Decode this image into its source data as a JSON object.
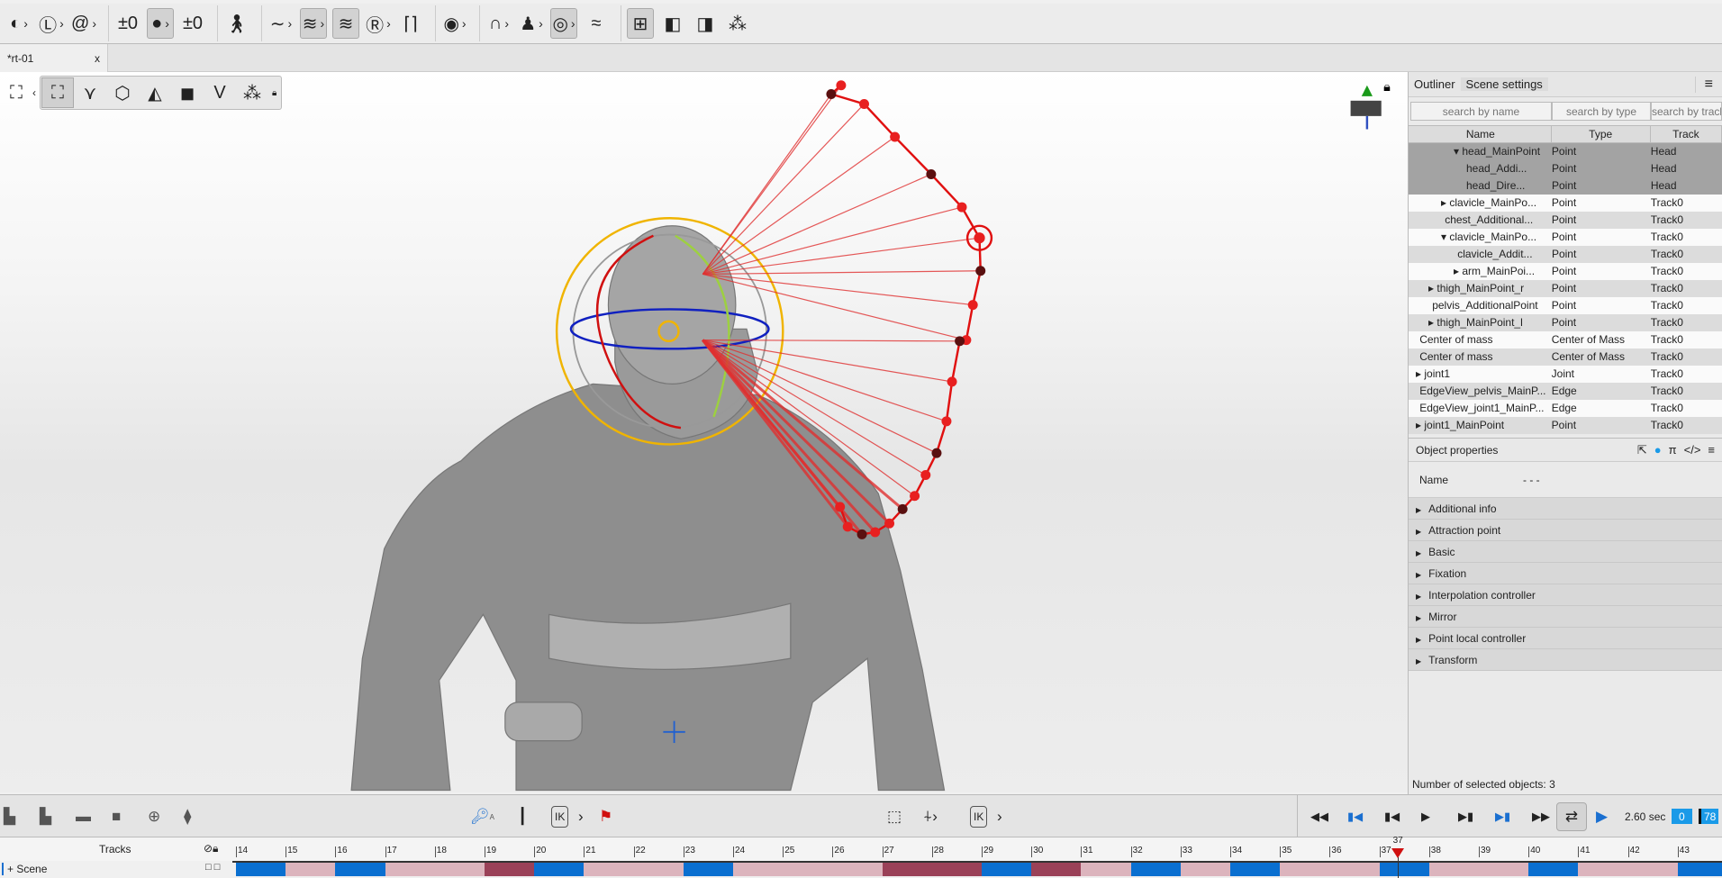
{
  "toolbar": [
    {
      "icon": "globe-icon",
      "glyph": "◐",
      "chev": true
    },
    {
      "icon": "local-L-icon",
      "glyph": "Ⓛ",
      "chev": true
    },
    {
      "icon": "spiral-icon",
      "glyph": "@",
      "chev": true,
      "sep": true
    },
    {
      "icon": "plus-zero-icon",
      "glyph": "±0"
    },
    {
      "icon": "dot-key-icon",
      "glyph": "●",
      "chev": true,
      "on": true
    },
    {
      "icon": "plus-zero-icon-2",
      "glyph": "±0",
      "sep": true
    },
    {
      "icon": "person-icon",
      "glyph": "🚶︎",
      "sep": true
    },
    {
      "icon": "curve-icon",
      "glyph": "∼",
      "chev": true
    },
    {
      "icon": "wave-lock-icon",
      "glyph": "≋",
      "chev": true,
      "on": true
    },
    {
      "icon": "wave-pen-icon",
      "glyph": "≋",
      "on": true
    },
    {
      "icon": "r-icon",
      "glyph": "Ⓡ",
      "chev": true
    },
    {
      "icon": "bracket-icon",
      "glyph": "⌈⌉",
      "sep": true
    },
    {
      "icon": "camera-icon",
      "glyph": "◉",
      "chev": true,
      "sep": true
    },
    {
      "icon": "arc-add-icon",
      "glyph": "∩",
      "chev": true
    },
    {
      "icon": "figure-icon",
      "glyph": "♟",
      "chev": true
    },
    {
      "icon": "target-lock-icon",
      "glyph": "◎",
      "chev": true,
      "on": true
    },
    {
      "icon": "wave-icon",
      "glyph": "≈",
      "sep": true
    },
    {
      "icon": "grid-icon",
      "glyph": "⊞",
      "on": true
    },
    {
      "icon": "layer-add-icon",
      "glyph": "◧"
    },
    {
      "icon": "layer-remove-icon",
      "glyph": "◨"
    },
    {
      "icon": "nodes-p-icon",
      "glyph": "⁂"
    }
  ],
  "tab": {
    "label": "*rt-01",
    "close": "x"
  },
  "viewtools": [
    "frame-icon",
    "bone-icon",
    "cube-wire-icon",
    "cube-edge-icon",
    "cube-solid-icon",
    "v-icon",
    "nodes-icon"
  ],
  "outliner": {
    "tabs": [
      "Outliner",
      "Scene settings"
    ],
    "menu": "≡",
    "search": [
      "search by name",
      "search by type",
      "search by track"
    ],
    "columns": [
      "Name",
      "Type",
      "Track"
    ],
    "rows": [
      {
        "name": "▾ head_MainPoint",
        "type": "Point",
        "track": "Head",
        "indent": 3,
        "style": "sel"
      },
      {
        "name": "head_Addi...",
        "type": "Point",
        "track": "Head",
        "indent": 4,
        "style": "sel"
      },
      {
        "name": "head_Dire...",
        "type": "Point",
        "track": "Head",
        "indent": 4,
        "style": "sel"
      },
      {
        "name": "▸ clavicle_MainPo...",
        "type": "Point",
        "track": "Track0",
        "indent": 2,
        "style": "plain"
      },
      {
        "name": "chest_Additional...",
        "type": "Point",
        "track": "Track0",
        "indent": 2.3,
        "style": "alt"
      },
      {
        "name": "▾ clavicle_MainPo...",
        "type": "Point",
        "track": "Track0",
        "indent": 2,
        "style": "plain"
      },
      {
        "name": "clavicle_Addit...",
        "type": "Point",
        "track": "Track0",
        "indent": 3.3,
        "style": "alt"
      },
      {
        "name": "▸ arm_MainPoi...",
        "type": "Point",
        "track": "Track0",
        "indent": 3,
        "style": "plain"
      },
      {
        "name": "▸ thigh_MainPoint_r",
        "type": "Point",
        "track": "Track0",
        "indent": 1,
        "style": "alt"
      },
      {
        "name": "pelvis_AdditionalPoint",
        "type": "Point",
        "track": "Track0",
        "indent": 1.3,
        "style": "plain"
      },
      {
        "name": "▸ thigh_MainPoint_l",
        "type": "Point",
        "track": "Track0",
        "indent": 1,
        "style": "alt"
      },
      {
        "name": "Center of mass",
        "type": "Center of Mass",
        "track": "Track0",
        "indent": 0.3,
        "style": "plain"
      },
      {
        "name": "Center of mass",
        "type": "Center of Mass",
        "track": "Track0",
        "indent": 0.3,
        "style": "alt"
      },
      {
        "name": "▸ joint1",
        "type": "Joint",
        "track": "Track0",
        "indent": 0,
        "style": "plain"
      },
      {
        "name": "EdgeView_pelvis_MainP...",
        "type": "Edge",
        "track": "Track0",
        "indent": 0.3,
        "style": "alt"
      },
      {
        "name": "EdgeView_joint1_MainP...",
        "type": "Edge",
        "track": "Track0",
        "indent": 0.3,
        "style": "plain"
      },
      {
        "name": "▸ joint1_MainPoint",
        "type": "Point",
        "track": "Track0",
        "indent": 0,
        "style": "alt"
      }
    ]
  },
  "properties": {
    "title": "Object properties",
    "icons": [
      {
        "icon": "add-icon",
        "glyph": "⇱"
      },
      {
        "icon": "color-drop-icon",
        "glyph": "●"
      },
      {
        "icon": "pi-icon",
        "glyph": "π"
      },
      {
        "icon": "code-icon",
        "glyph": "</>"
      },
      {
        "icon": "menu-icon",
        "glyph": "≡"
      }
    ],
    "name_label": "Name",
    "name_value": "- - -",
    "sections": [
      "Additional info",
      "Attraction point",
      "Basic",
      "Fixation",
      "Interpolation controller",
      "Mirror",
      "Point local controller",
      "Transform"
    ]
  },
  "status": "Number of selected objects: 3",
  "bottom": {
    "left_icons": [
      "track-add-icon",
      "track-add-child-icon",
      "track-remove-icon",
      "track-solid-icon",
      "track-center-icon",
      "track-split-icon"
    ],
    "key_label": "A",
    "ik_label": "IK",
    "ik_label2": "IK",
    "playback": [
      {
        "icon": "rewind-icon",
        "glyph": "◀◀"
      },
      {
        "icon": "first-key-icon",
        "glyph": "▮◀"
      },
      {
        "icon": "prev-frame-icon",
        "glyph": "▮◀"
      },
      {
        "icon": "play-icon",
        "glyph": "▶"
      },
      {
        "icon": "next-frame-icon",
        "glyph": "▶▮"
      },
      {
        "icon": "last-key-icon",
        "glyph": "▶▮"
      },
      {
        "icon": "fast-forward-icon",
        "glyph": "▶▶"
      }
    ],
    "time": "2.60 sec",
    "range_start": "0",
    "range_end": "78"
  },
  "timeline": {
    "tracks_label": "Tracks",
    "scene_label": "Scene",
    "current_frame": "37",
    "frames": [
      14,
      15,
      16,
      17,
      18,
      19,
      20,
      21,
      22,
      23,
      24,
      25,
      26,
      27,
      28,
      29,
      30,
      31,
      32,
      33,
      34,
      35,
      36,
      37,
      38,
      39,
      40,
      41,
      42,
      43
    ],
    "segments": [
      "b",
      "p",
      "b",
      "p",
      "p",
      "m",
      "b",
      "p",
      "p",
      "b",
      "p",
      "p",
      "p",
      "m",
      "m",
      "b",
      "m",
      "p",
      "b",
      "p",
      "b",
      "p",
      "p",
      "b",
      "p",
      "p",
      "b",
      "p",
      "p",
      "b"
    ],
    "colors": {
      "b": "#0a6fd0",
      "p": "#dcb4bd",
      "m": "#9a4158",
      "playhead": "#d01010"
    }
  }
}
